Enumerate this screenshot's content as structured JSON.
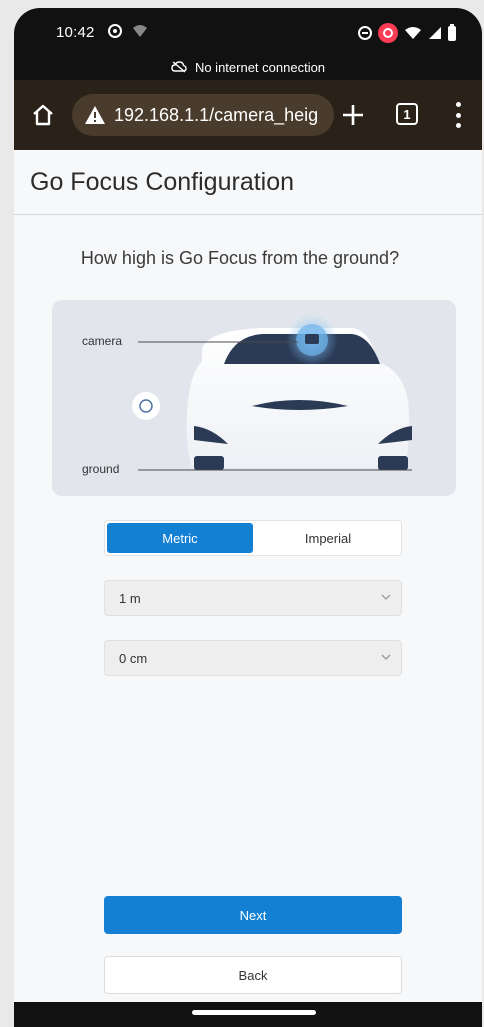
{
  "status_bar": {
    "time": "10:42"
  },
  "offline_banner": {
    "text": "No internet connection"
  },
  "browser": {
    "url": "192.168.1.1/camera_heig",
    "tab_count": "1"
  },
  "page": {
    "title": "Go Focus Configuration",
    "question": "How high is Go Focus from the ground?"
  },
  "illustration": {
    "camera_label": "camera",
    "ground_label": "ground"
  },
  "unit_toggle": {
    "metric_label": "Metric",
    "imperial_label": "Imperial",
    "selected": "Metric"
  },
  "height_meters": {
    "value": "1 m"
  },
  "height_centimeters": {
    "value": "0 cm"
  },
  "actions": {
    "next_label": "Next",
    "back_label": "Back"
  },
  "colors": {
    "accent": "#1480d4",
    "url_bar_bg": "#2a2218"
  }
}
